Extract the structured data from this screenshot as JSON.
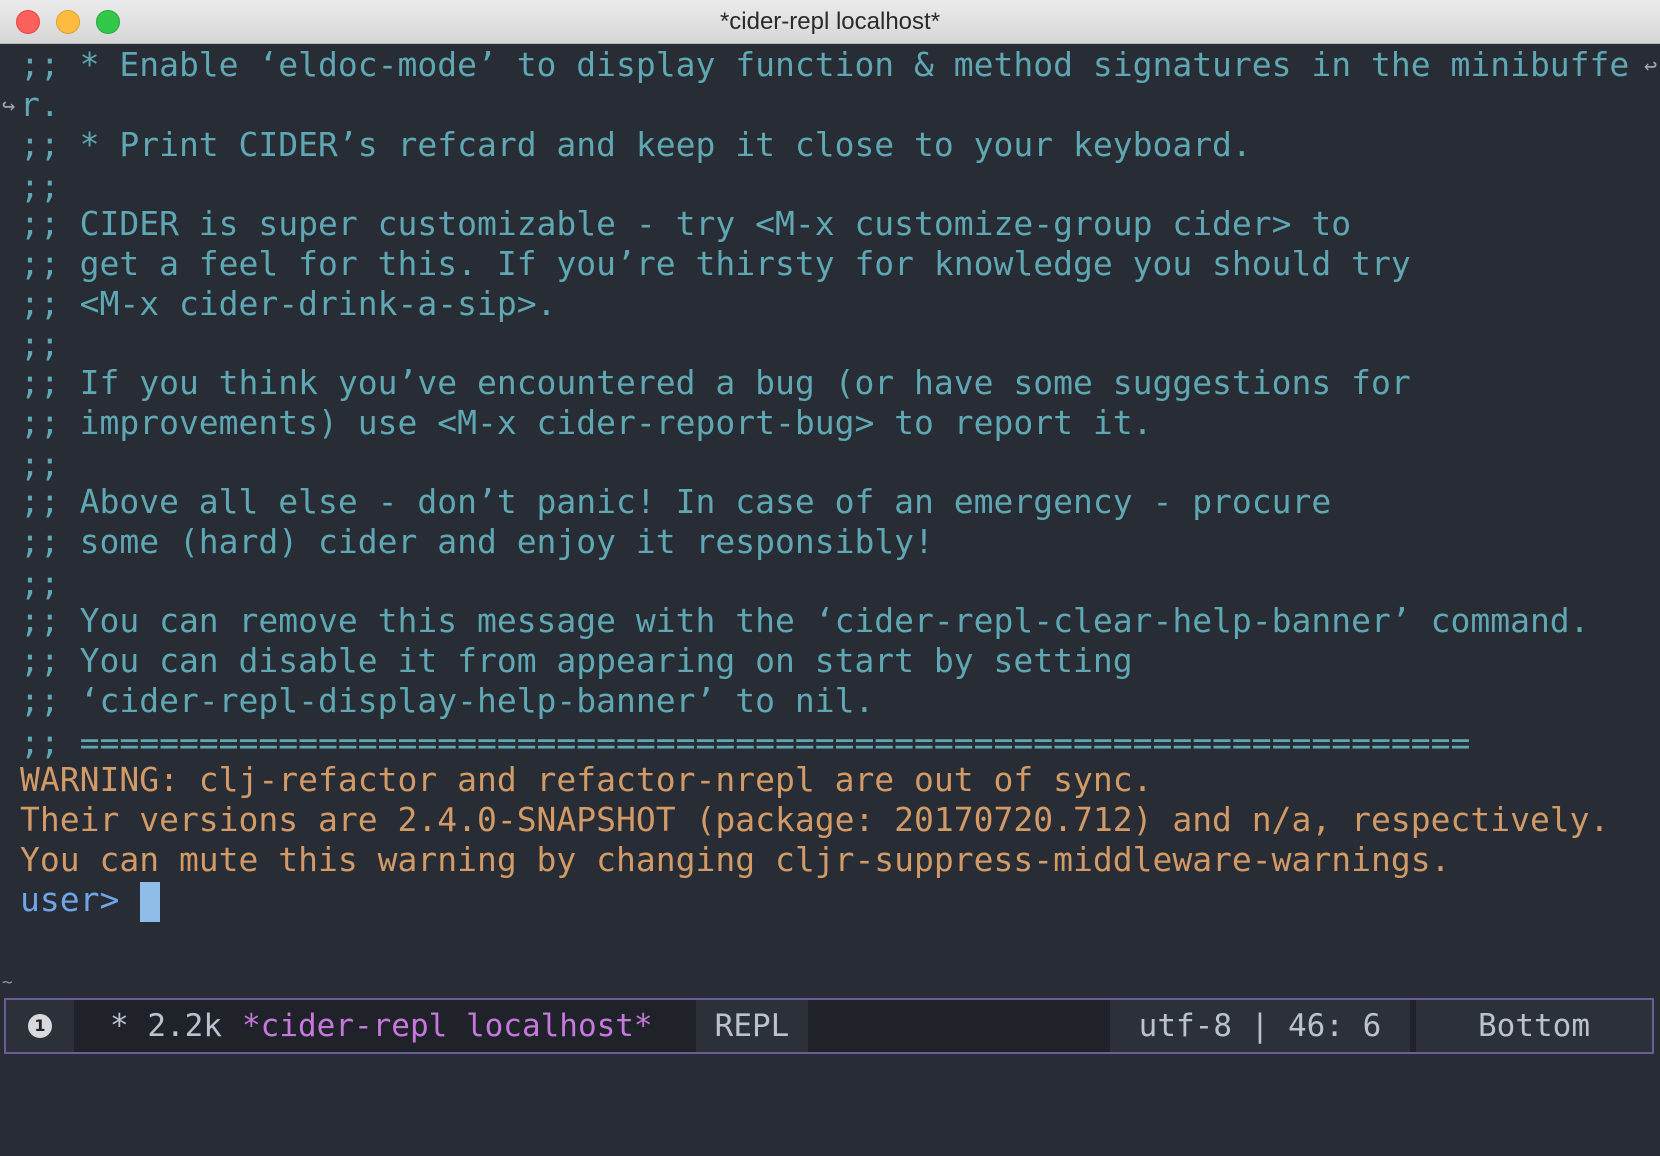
{
  "window": {
    "title": "*cider-repl localhost*"
  },
  "buffer": {
    "comment_lines": [
      ";; * Enable ‘eldoc-mode’ to display function & method signatures in the minibuffe",
      "r.",
      ";; * Print CIDER’s refcard and keep it close to your keyboard.",
      ";;",
      ";; CIDER is super customizable - try <M-x customize-group cider> to",
      ";; get a feel for this. If you’re thirsty for knowledge you should try",
      ";; <M-x cider-drink-a-sip>.",
      ";;",
      ";; If you think you’ve encountered a bug (or have some suggestions for",
      ";; improvements) use <M-x cider-report-bug> to report it.",
      ";;",
      ";; Above all else - don’t panic! In case of an emergency - procure",
      ";; some (hard) cider and enjoy it responsibly!",
      ";;",
      ";; You can remove this message with the ‘cider-repl-clear-help-banner’ command.",
      ";; You can disable it from appearing on start by setting",
      ";; ‘cider-repl-display-help-banner’ to nil.",
      ";; ======================================================================"
    ],
    "warning_lines": [
      "WARNING: clj-refactor and refactor-nrepl are out of sync.",
      "Their versions are 2.4.0-SNAPSHOT (package: 20170720.712) and n/a, respectively.",
      "You can mute this warning by changing cljr-suppress-middleware-warnings."
    ],
    "prompt": "user>"
  },
  "modeline": {
    "window_number": "1",
    "modified_size": "* 2.2k",
    "buffer_name": "*cider-repl localhost*",
    "mode": "REPL",
    "encoding_position": "utf-8 | 46: 6",
    "scroll_position": "Bottom"
  },
  "colors": {
    "background": "#282c34",
    "comment": "#5fa7b3",
    "warning": "#d19a66",
    "prompt": "#6ea6e8",
    "buffer_name": "#c678dd"
  }
}
